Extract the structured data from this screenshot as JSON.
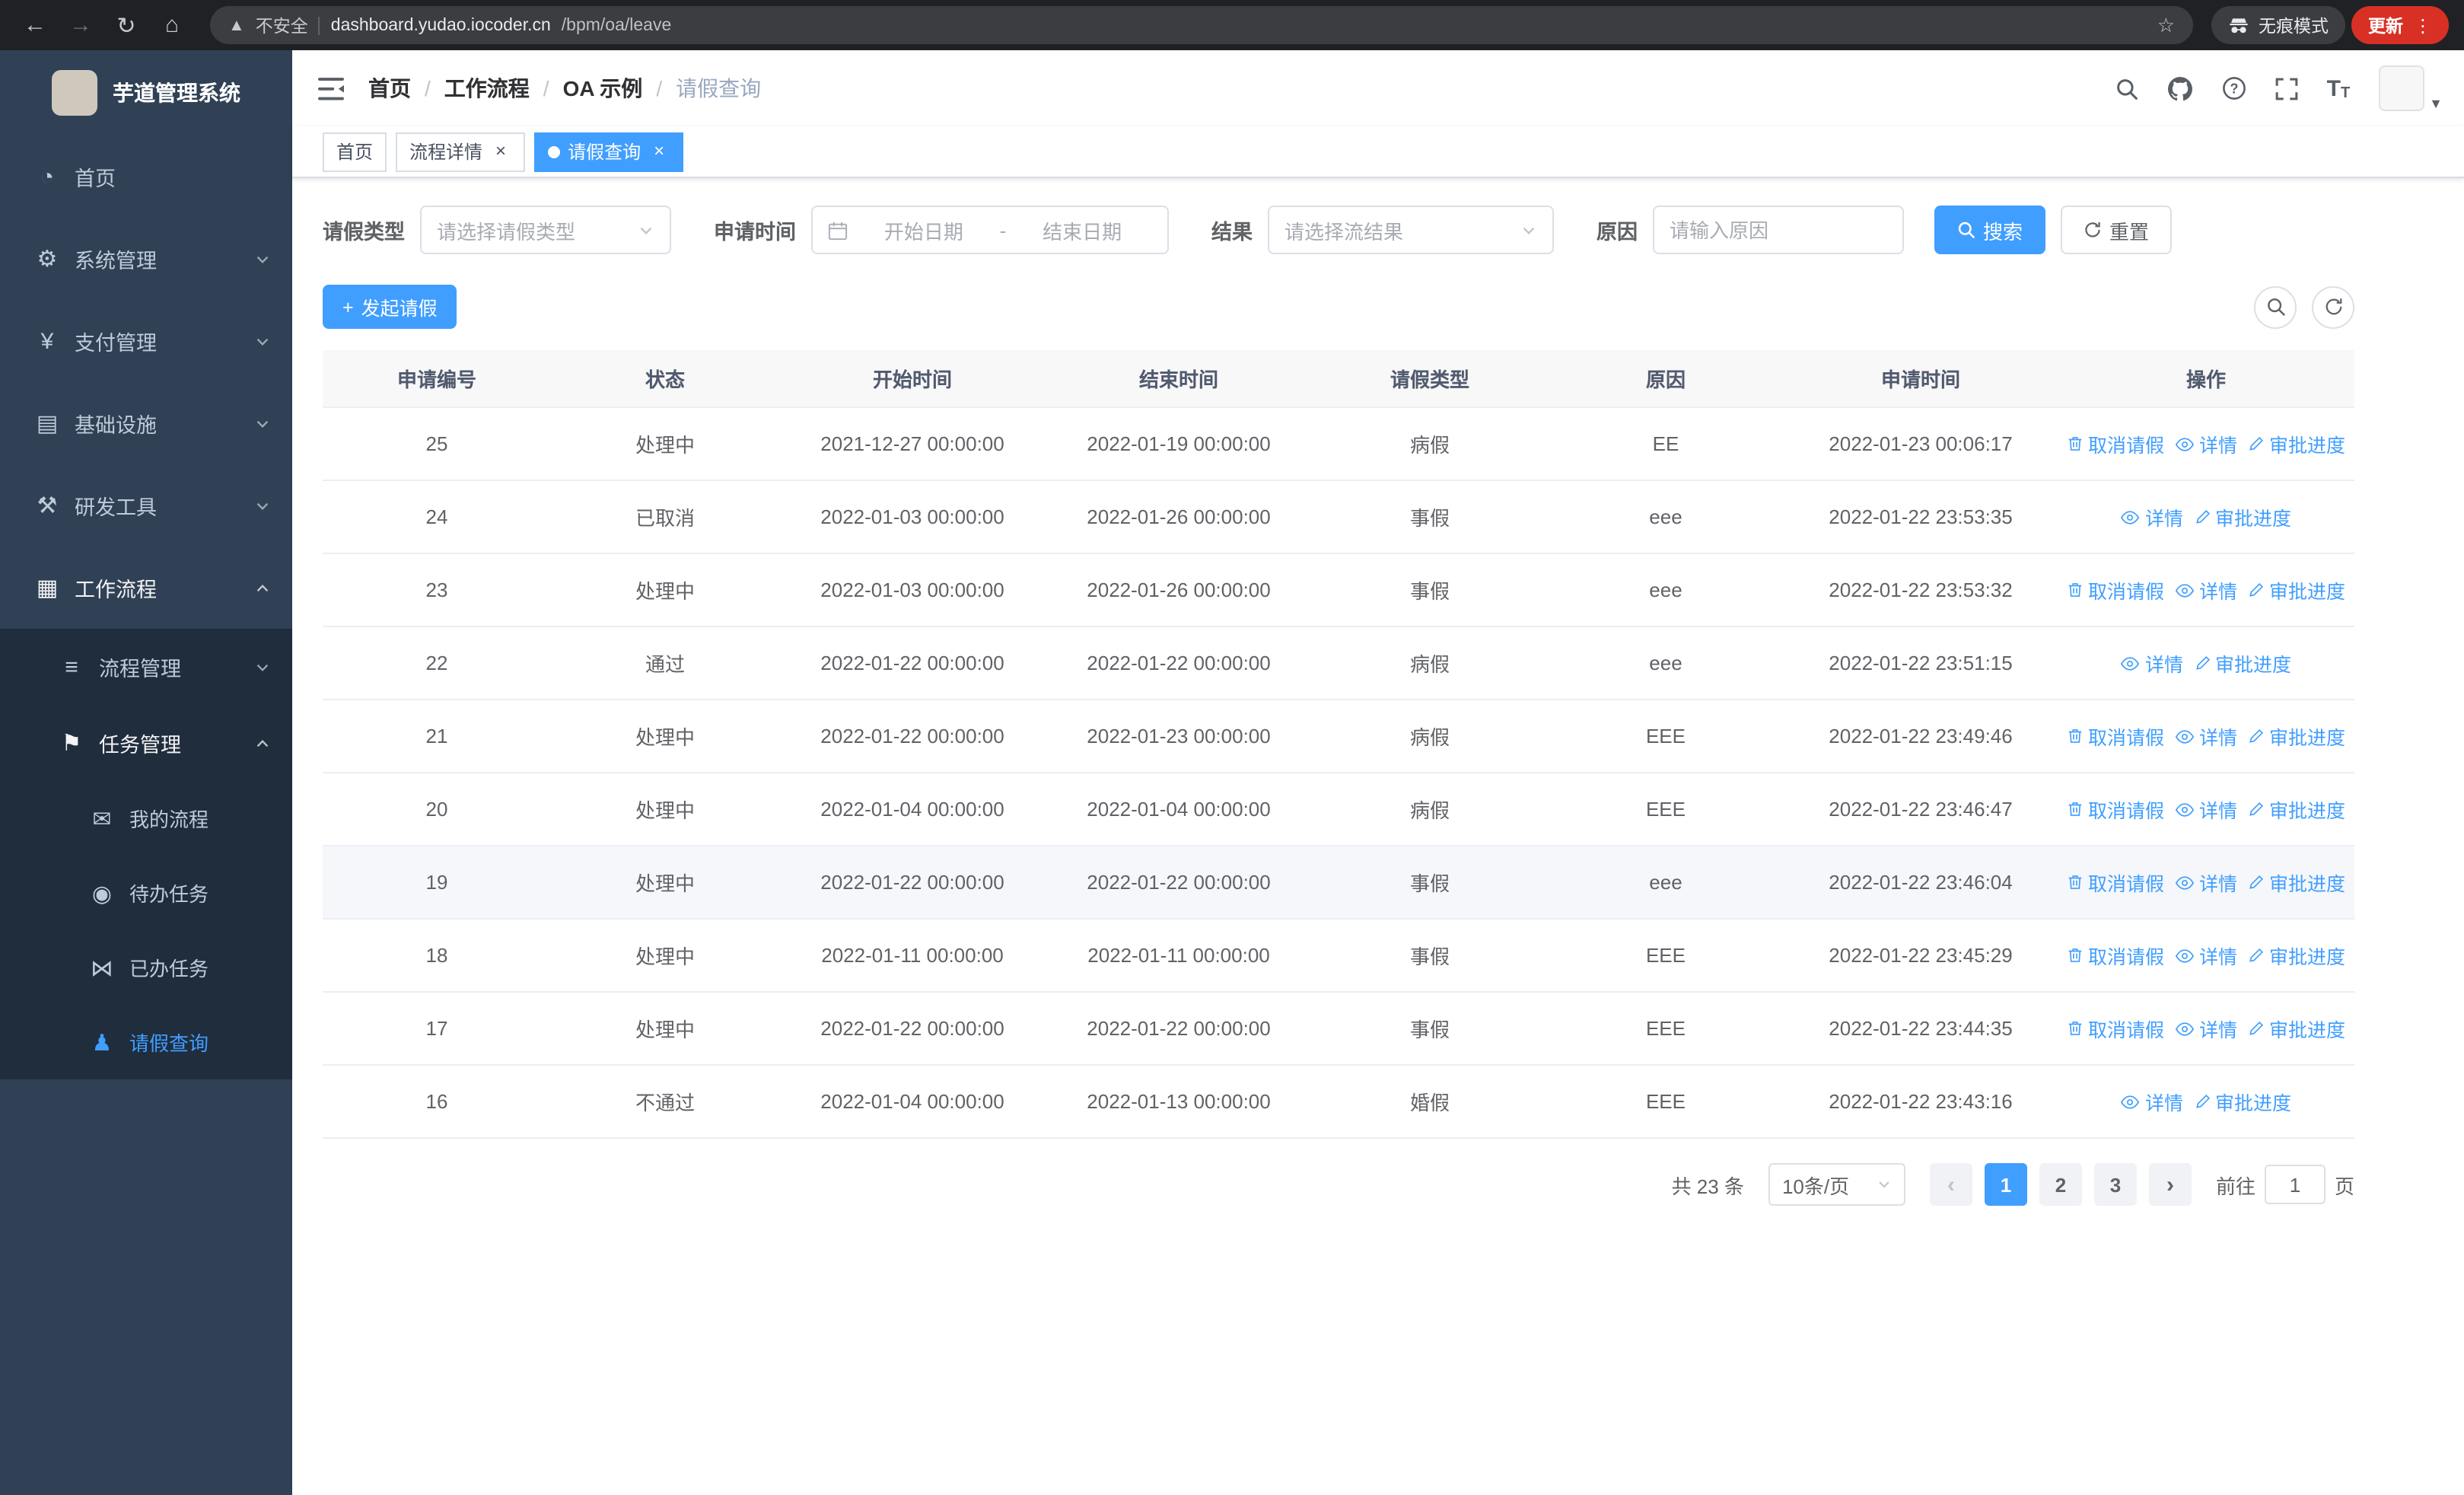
{
  "browser": {
    "url_host": "dashboard.yudao.iocoder.cn",
    "url_path": "/bpm/oa/leave",
    "security_label": "不安全",
    "incognito_label": "无痕模式",
    "update_label": "更新"
  },
  "sidebar": {
    "logo_title": "芋道管理系统",
    "items": [
      {
        "label": "首页",
        "icon": "dashboard-icon",
        "depth": 0
      },
      {
        "label": "系统管理",
        "icon": "gear-icon",
        "depth": 0,
        "chevron": "down"
      },
      {
        "label": "支付管理",
        "icon": "yen-icon",
        "depth": 0,
        "chevron": "down"
      },
      {
        "label": "基础设施",
        "icon": "monitor-icon",
        "depth": 0,
        "chevron": "down"
      },
      {
        "label": "研发工具",
        "icon": "tool-icon",
        "depth": 0,
        "chevron": "down"
      },
      {
        "label": "工作流程",
        "icon": "workflow-icon",
        "depth": 0,
        "chevron": "up",
        "open": true
      },
      {
        "label": "流程管理",
        "icon": "process-icon",
        "depth": 1,
        "chevron": "down"
      },
      {
        "label": "任务管理",
        "icon": "task-icon",
        "depth": 1,
        "chevron": "up",
        "open": true
      },
      {
        "label": "我的流程",
        "icon": "chat-icon",
        "depth": 2
      },
      {
        "label": "待办任务",
        "icon": "eye-icon",
        "depth": 2
      },
      {
        "label": "已办任务",
        "icon": "done-icon",
        "depth": 2
      },
      {
        "label": "请假查询",
        "icon": "user-icon",
        "depth": 2,
        "active": true
      }
    ]
  },
  "breadcrumb": {
    "items": [
      "首页",
      "工作流程",
      "OA 示例",
      "请假查询"
    ]
  },
  "tags": [
    {
      "label": "首页",
      "closable": false,
      "active": false
    },
    {
      "label": "流程详情",
      "closable": true,
      "active": false
    },
    {
      "label": "请假查询",
      "closable": true,
      "active": true
    }
  ],
  "filters": {
    "leave_type_label": "请假类型",
    "leave_type_placeholder": "请选择请假类型",
    "apply_time_label": "申请时间",
    "start_date_placeholder": "开始日期",
    "range_separator": "-",
    "end_date_placeholder": "结束日期",
    "result_label": "结果",
    "result_placeholder": "请选择流结果",
    "reason_label": "原因",
    "reason_placeholder": "请输入原因",
    "search_button": "搜索",
    "reset_button": "重置"
  },
  "toolbar": {
    "create_button": "发起请假"
  },
  "table": {
    "columns": [
      "申请编号",
      "状态",
      "开始时间",
      "结束时间",
      "请假类型",
      "原因",
      "申请时间",
      "操作"
    ],
    "actions": {
      "cancel": "取消请假",
      "detail": "详情",
      "progress": "审批进度"
    },
    "rows": [
      {
        "id": "25",
        "status": "处理中",
        "start": "2021-12-27 00:00:00",
        "end": "2022-01-19 00:00:00",
        "type": "病假",
        "reason": "EE",
        "applied": "2022-01-23 00:06:17",
        "cancel": true,
        "highlighted": false
      },
      {
        "id": "24",
        "status": "已取消",
        "start": "2022-01-03 00:00:00",
        "end": "2022-01-26 00:00:00",
        "type": "事假",
        "reason": "eee",
        "applied": "2022-01-22 23:53:35",
        "cancel": false,
        "highlighted": false
      },
      {
        "id": "23",
        "status": "处理中",
        "start": "2022-01-03 00:00:00",
        "end": "2022-01-26 00:00:00",
        "type": "事假",
        "reason": "eee",
        "applied": "2022-01-22 23:53:32",
        "cancel": true,
        "highlighted": false
      },
      {
        "id": "22",
        "status": "通过",
        "start": "2022-01-22 00:00:00",
        "end": "2022-01-22 00:00:00",
        "type": "病假",
        "reason": "eee",
        "applied": "2022-01-22 23:51:15",
        "cancel": false,
        "highlighted": false
      },
      {
        "id": "21",
        "status": "处理中",
        "start": "2022-01-22 00:00:00",
        "end": "2022-01-23 00:00:00",
        "type": "病假",
        "reason": "EEE",
        "applied": "2022-01-22 23:49:46",
        "cancel": true,
        "highlighted": false
      },
      {
        "id": "20",
        "status": "处理中",
        "start": "2022-01-04 00:00:00",
        "end": "2022-01-04 00:00:00",
        "type": "病假",
        "reason": "EEE",
        "applied": "2022-01-22 23:46:47",
        "cancel": true,
        "highlighted": false
      },
      {
        "id": "19",
        "status": "处理中",
        "start": "2022-01-22 00:00:00",
        "end": "2022-01-22 00:00:00",
        "type": "事假",
        "reason": "eee",
        "applied": "2022-01-22 23:46:04",
        "cancel": true,
        "highlighted": true
      },
      {
        "id": "18",
        "status": "处理中",
        "start": "2022-01-11 00:00:00",
        "end": "2022-01-11 00:00:00",
        "type": "事假",
        "reason": "EEE",
        "applied": "2022-01-22 23:45:29",
        "cancel": true,
        "highlighted": false
      },
      {
        "id": "17",
        "status": "处理中",
        "start": "2022-01-22 00:00:00",
        "end": "2022-01-22 00:00:00",
        "type": "事假",
        "reason": "EEE",
        "applied": "2022-01-22 23:44:35",
        "cancel": true,
        "highlighted": false
      },
      {
        "id": "16",
        "status": "不通过",
        "start": "2022-01-04 00:00:00",
        "end": "2022-01-13 00:00:00",
        "type": "婚假",
        "reason": "EEE",
        "applied": "2022-01-22 23:43:16",
        "cancel": false,
        "highlighted": false
      }
    ]
  },
  "pagination": {
    "total": "共 23 条",
    "page_size": "10条/页",
    "pages": [
      "1",
      "2",
      "3"
    ],
    "active_page": "1",
    "goto_label": "前往",
    "goto_value": "1",
    "goto_suffix": "页"
  },
  "colors": {
    "primary": "#409eff",
    "sidebar_bg": "#304156",
    "submenu_bg": "#1f2d3d"
  }
}
